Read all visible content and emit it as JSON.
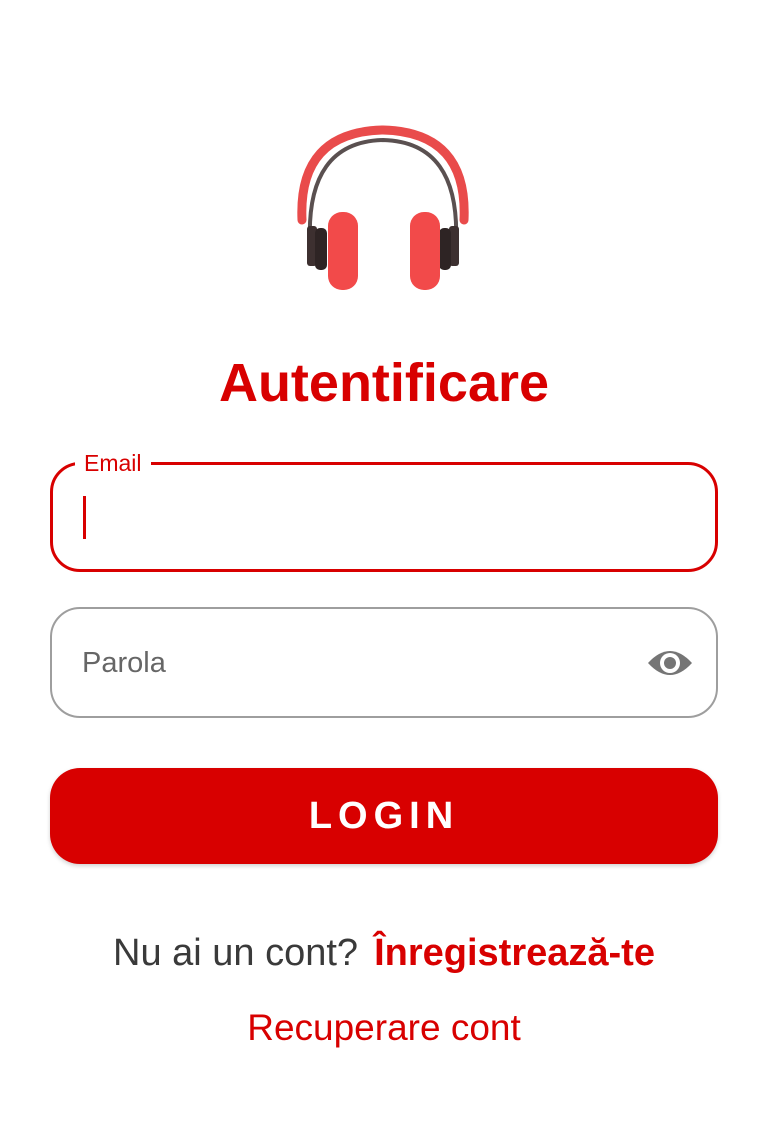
{
  "logo": {
    "icon": "headphones-icon",
    "colors": {
      "band": "#e94b4b",
      "inner_band": "#5a5050",
      "ear_cushion": "#f24a4a",
      "ear_cup": "#3d3030"
    }
  },
  "title": "Autentificare",
  "email": {
    "label": "Email",
    "value": ""
  },
  "password": {
    "placeholder": "Parola",
    "toggle_icon": "eye-icon"
  },
  "login_button": "LOGIN",
  "signup": {
    "question": "Nu ai un cont?",
    "link": "Înregistrează-te"
  },
  "recover_link": "Recuperare cont",
  "colors": {
    "accent": "#d80000",
    "field_border_inactive": "#9e9e9e",
    "text_dark": "#3a3a3a",
    "text_placeholder": "#666666",
    "background": "#ffffff"
  }
}
